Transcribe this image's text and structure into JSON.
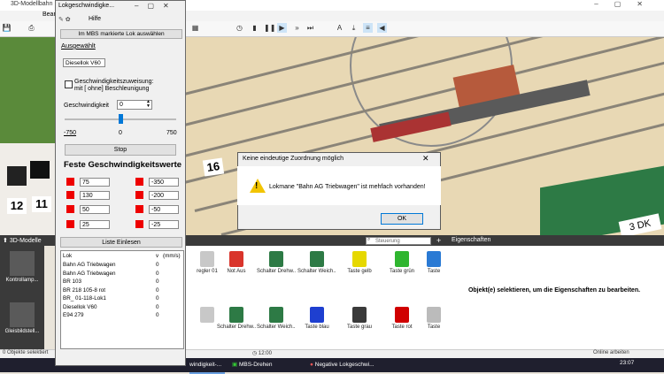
{
  "app": {
    "title": "3D-Modellbahn",
    "tab": "Bear"
  },
  "lok_window": {
    "title": "Lokgeschwindigke...",
    "menu_help": "Hilfe",
    "select_button": "Im MBS markierte Lok auswählen",
    "section_selected": "Ausgewählt",
    "current_loco": "Diesellok V60",
    "checkbox_label_line1": "Geschwindigkeitszuweisung:",
    "checkbox_label_line2": "mit [ ohne] Beschleunigung",
    "speed_label": "Geschwindigkeit",
    "speed_value": "0",
    "slider_min": "-750",
    "slider_mid": "0",
    "slider_max": "750",
    "stop_button": "Stop",
    "fixed_speeds_title": "Feste Geschwindigkeitswerte",
    "fixed_left": [
      "75",
      "130",
      "50",
      "25"
    ],
    "fixed_right": [
      "-350",
      "-200",
      "-50",
      "-25"
    ],
    "list_button": "Liste Einlesen",
    "list_header_lok": "Lok",
    "list_header_v": "v",
    "list_header_unit": "(mm/s)",
    "list": [
      {
        "name": "Bahn AG Triebwagen",
        "v": "0"
      },
      {
        "name": "Bahn AG Triebwagen",
        "v": "0"
      },
      {
        "name": "BR 103",
        "v": "0"
      },
      {
        "name": "BR 218 105-8 rot",
        "v": "0"
      },
      {
        "name": "BR_ 01-118-Lok1",
        "v": "0"
      },
      {
        "name": "Diesellok V60",
        "v": "0"
      },
      {
        "name": "E94 279",
        "v": "0"
      }
    ]
  },
  "message_box": {
    "title": "Keine eindeutige Zuordnung möglich",
    "text": "Lokmane \"Bahn AG Triebwagen\" ist mehfach vorhanden!",
    "ok": "OK"
  },
  "scene_labels": {
    "n16": "16",
    "n12": "12",
    "n11": "11",
    "dk": "3 DK"
  },
  "bottom": {
    "models_label": "3D-Modelle",
    "search_placeholder": "Steuerung durchsuchen",
    "plus": "+",
    "properties_label": "Eigenschaften",
    "properties_msg": "Objekt(e) selektieren, um die Eigenschaften zu bearbeiten.",
    "categories": [
      "Kontrollamp...",
      "Gleisbildstell..."
    ],
    "palette_row1": [
      {
        "label": "regler 01",
        "color": "#c8c8c8"
      },
      {
        "label": "Not Aus",
        "color": "#d9342b"
      },
      {
        "label": "Schalter Drehw...",
        "color": "#2d7a45"
      },
      {
        "label": "Schalter Weich...",
        "color": "#2d7a45"
      },
      {
        "label": "Taste gelb",
        "color": "#e6d800"
      },
      {
        "label": "Taste grün",
        "color": "#2fb52f"
      },
      {
        "label": "Taste",
        "color": "#2a7ad4"
      }
    ],
    "palette_row2": [
      {
        "label": "",
        "color": "#c8c8c8"
      },
      {
        "label": "Schalter Drehw...",
        "color": "#2d7a45"
      },
      {
        "label": "Schalter Weich...",
        "color": "#2d7a45"
      },
      {
        "label": "Taste blau",
        "color": "#1e3fd0"
      },
      {
        "label": "Taste grau",
        "color": "#3a3a3a"
      },
      {
        "label": "Taste rot",
        "color": "#d00000"
      },
      {
        "label": "Taste",
        "color": "#bbbbbb"
      }
    ]
  },
  "status": {
    "left": "0 Objekte selektiert",
    "time": "12:00",
    "right": "Online arbeiten"
  },
  "taskbar": {
    "task1": "windigkeit-...",
    "task2": "MBS-Drehen",
    "task3": "Negative Lokgeschwi...",
    "clock": "23:07"
  }
}
